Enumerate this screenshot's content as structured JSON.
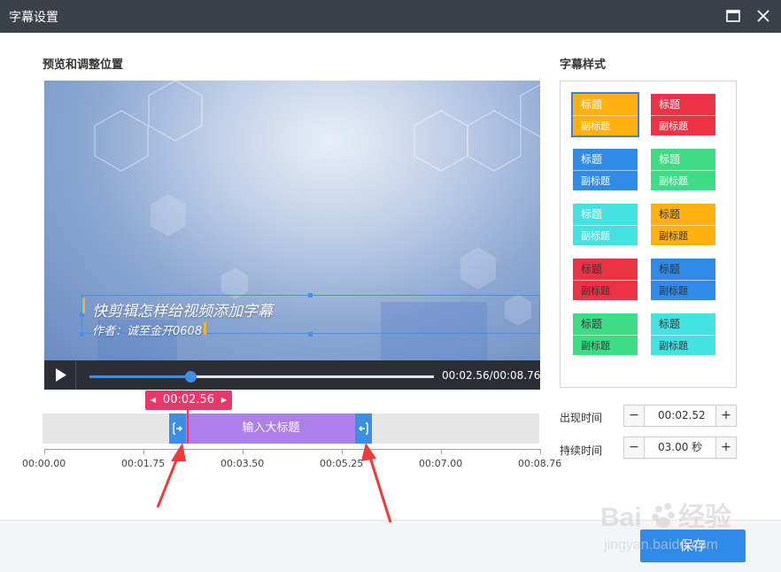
{
  "window": {
    "title": "字幕设置"
  },
  "preview": {
    "heading": "预览和调整位置",
    "subtitle_title": "快剪辑怎样给视频添加字幕",
    "subtitle_author": "作者：诚至金开0608",
    "time_display": "00:02.56/00:08.76",
    "progress_fraction": 0.292
  },
  "timeline": {
    "current_time": "00:02.56",
    "clip_label": "输入大标题",
    "ticks": [
      "00:00.00",
      "00:01.75",
      "00:03.50",
      "00:05.25",
      "00:07.00",
      "00:08.76"
    ]
  },
  "style_panel": {
    "heading": "字幕样式",
    "cards": [
      {
        "title": "标题",
        "sub": "副标题",
        "top": "#ffb20f",
        "bottom": "#ffb20f",
        "title_color": "#ffffff",
        "sub_color": "#ffffff",
        "selected": true
      },
      {
        "title": "标题",
        "sub": "副标题",
        "top": "#ec3345",
        "bottom": "#ec3345",
        "title_color": "#ffffff",
        "sub_color": "#ffffff"
      },
      {
        "title": "标题",
        "sub": "副标题",
        "top": "#2f8ae8",
        "bottom": "#2f8ae8",
        "title_color": "#ffffff",
        "sub_color": "#ffffff"
      },
      {
        "title": "标题",
        "sub": "副标题",
        "top": "#3fdc86",
        "bottom": "#3fdc86",
        "title_color": "#ffffff",
        "sub_color": "#ffffff"
      },
      {
        "title": "标题",
        "sub": "副标题",
        "top": "#45e2e2",
        "bottom": "#45e2e2",
        "title_color": "#ffffff",
        "sub_color": "#ffffff"
      },
      {
        "title": "标题",
        "sub": "副标题",
        "top": "#ffb20f",
        "bottom": "#ffb20f",
        "title_color": "#333333",
        "sub_color": "#333333"
      },
      {
        "title": "标题",
        "sub": "副标题",
        "top": "#ec3345",
        "bottom": "#ec3345",
        "title_color": "#333333",
        "sub_color": "#333333"
      },
      {
        "title": "标题",
        "sub": "副标题",
        "top": "#2f8ae8",
        "bottom": "#2f8ae8",
        "title_color": "#333333",
        "sub_color": "#333333"
      },
      {
        "title": "标题",
        "sub": "副标题",
        "top": "#3fdc86",
        "bottom": "#3fdc86",
        "title_color": "#333333",
        "sub_color": "#333333"
      },
      {
        "title": "标题",
        "sub": "副标题",
        "top": "#45e2e2",
        "bottom": "#45e2e2",
        "title_color": "#333333",
        "sub_color": "#333333"
      }
    ]
  },
  "settings": {
    "appear_label": "出现时间",
    "appear_value": "00:02.52",
    "duration_label": "持续时间",
    "duration_value": "03.00 秒",
    "minus": "−",
    "plus": "+"
  },
  "footer": {
    "save_label": "保存"
  },
  "watermark": {
    "text": "Baidu经验",
    "url": "jingyan.baidu.com"
  },
  "colors": {
    "accent": "#2f8ae8",
    "playhead": "#e8386a",
    "clip": "#ad7fe8"
  }
}
